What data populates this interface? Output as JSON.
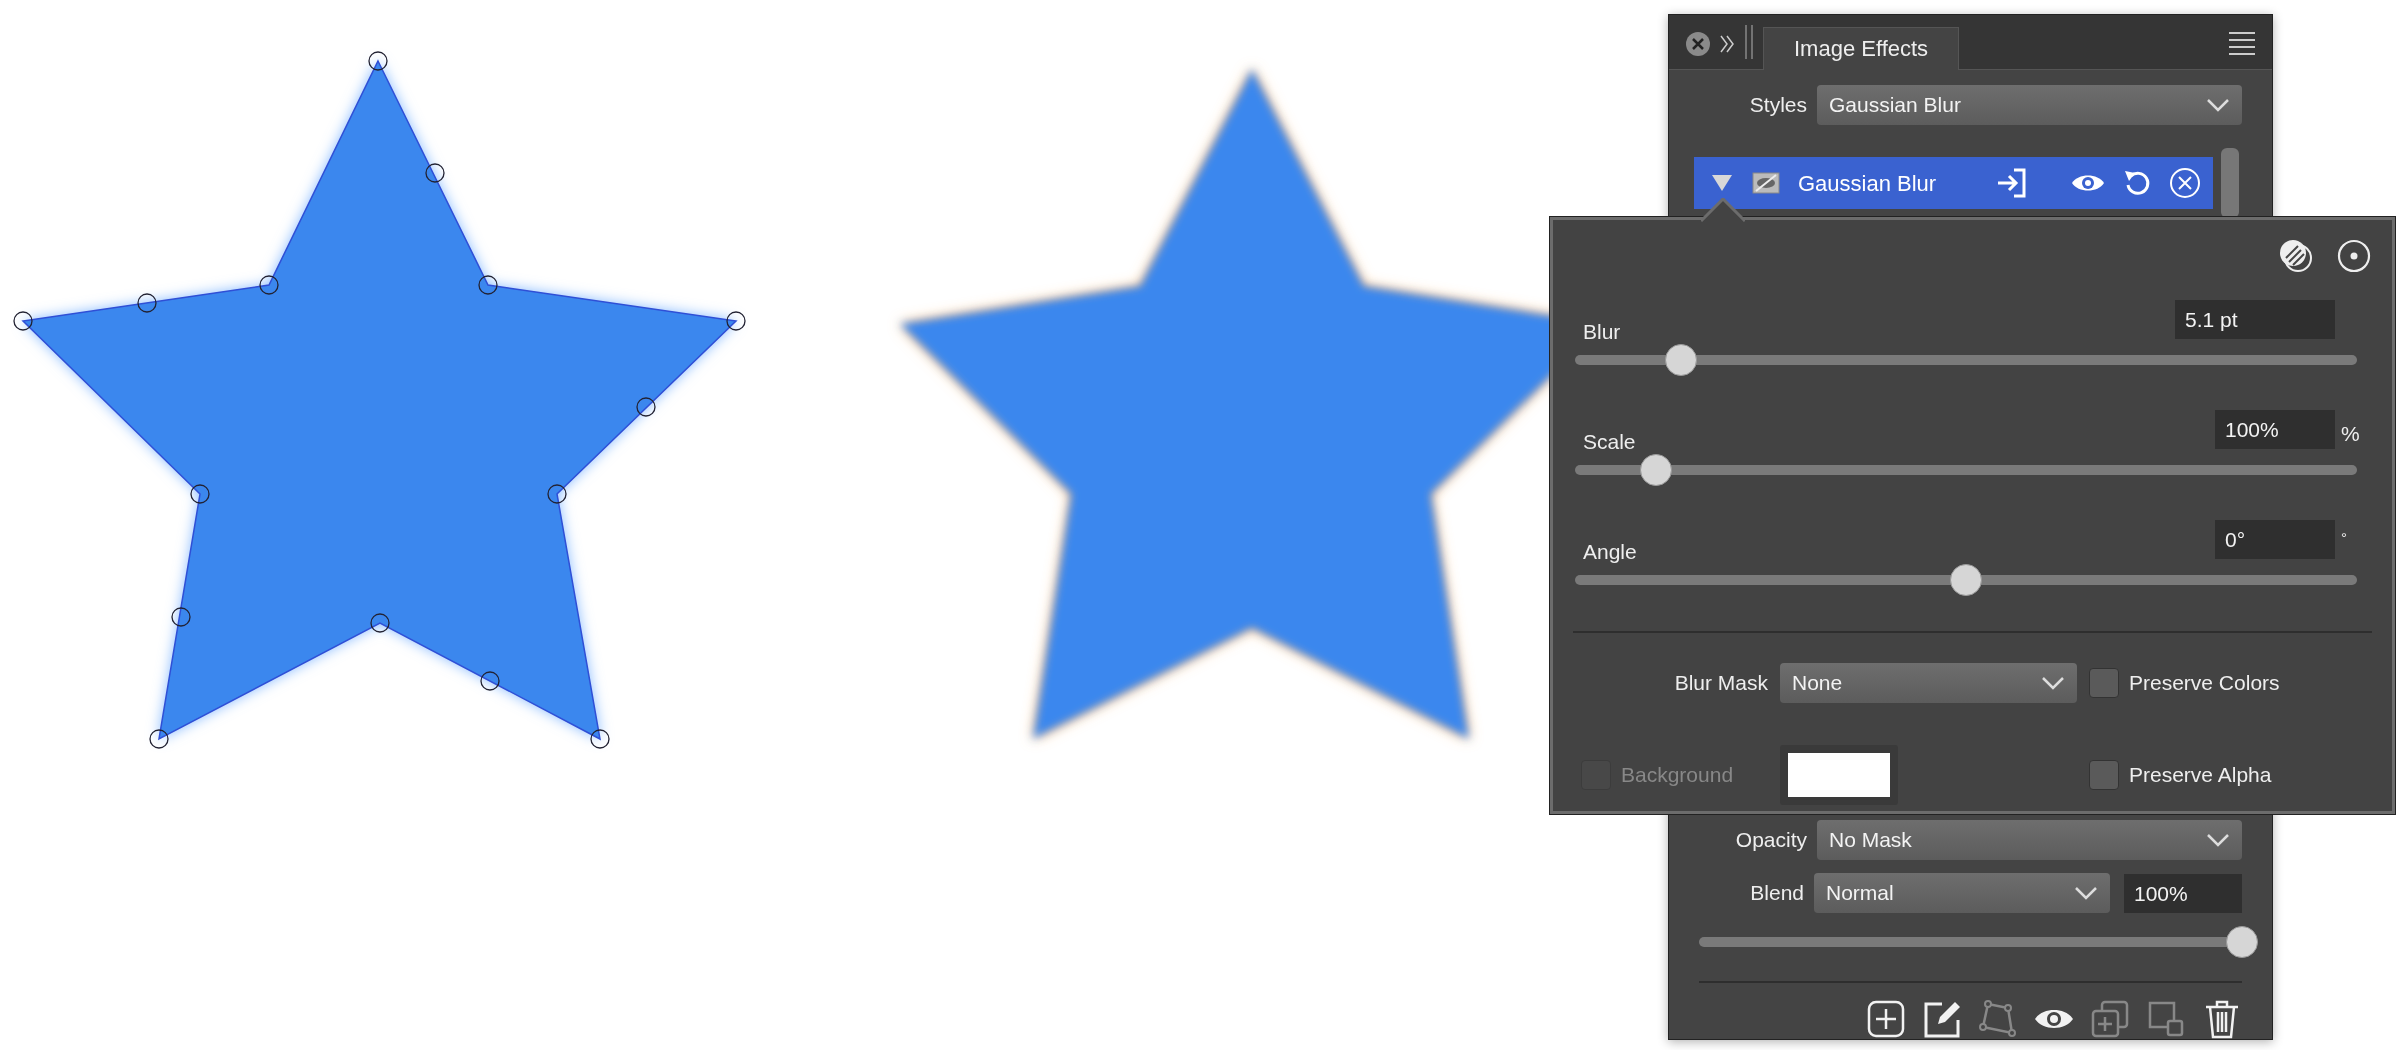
{
  "panel": {
    "tab": {
      "label": "Image Effects",
      "selected": true
    },
    "styles": {
      "label": "Styles",
      "value": "Gaussian Blur"
    },
    "effects": [
      {
        "name": "Gaussian Blur",
        "selected": true,
        "expanded": true
      }
    ],
    "opacity": {
      "label": "Opacity",
      "value": "No Mask"
    },
    "blend": {
      "label": "Blend",
      "value": "Normal",
      "amount": "100%",
      "level": 1
    },
    "toolbar": [
      {
        "kind": "add",
        "disabled": false
      },
      {
        "kind": "edit",
        "disabled": false
      },
      {
        "kind": "nodes",
        "disabled": true
      },
      {
        "kind": "eye",
        "disabled": false
      },
      {
        "kind": "duplicate",
        "disabled": true
      },
      {
        "kind": "arrange",
        "disabled": true
      },
      {
        "kind": "trash",
        "disabled": false
      }
    ]
  },
  "popup": {
    "sliders": [
      {
        "label": "Blur",
        "value": "5.1 pt",
        "level": 0.136
      },
      {
        "label": "Scale",
        "value": "100%",
        "unit": "%",
        "level": 0.103
      },
      {
        "label": "Angle",
        "value": "0°",
        "unit": "°",
        "level": 0.5
      }
    ],
    "blur_mask": {
      "label": "Blur Mask",
      "value": "None"
    },
    "background": {
      "label": "Background",
      "checked": false,
      "disabled": true,
      "color": "#ffffff"
    },
    "options": [
      {
        "label": "Preserve Colors",
        "checked": false
      },
      {
        "label": "Preserve Alpha",
        "checked": false
      }
    ]
  }
}
